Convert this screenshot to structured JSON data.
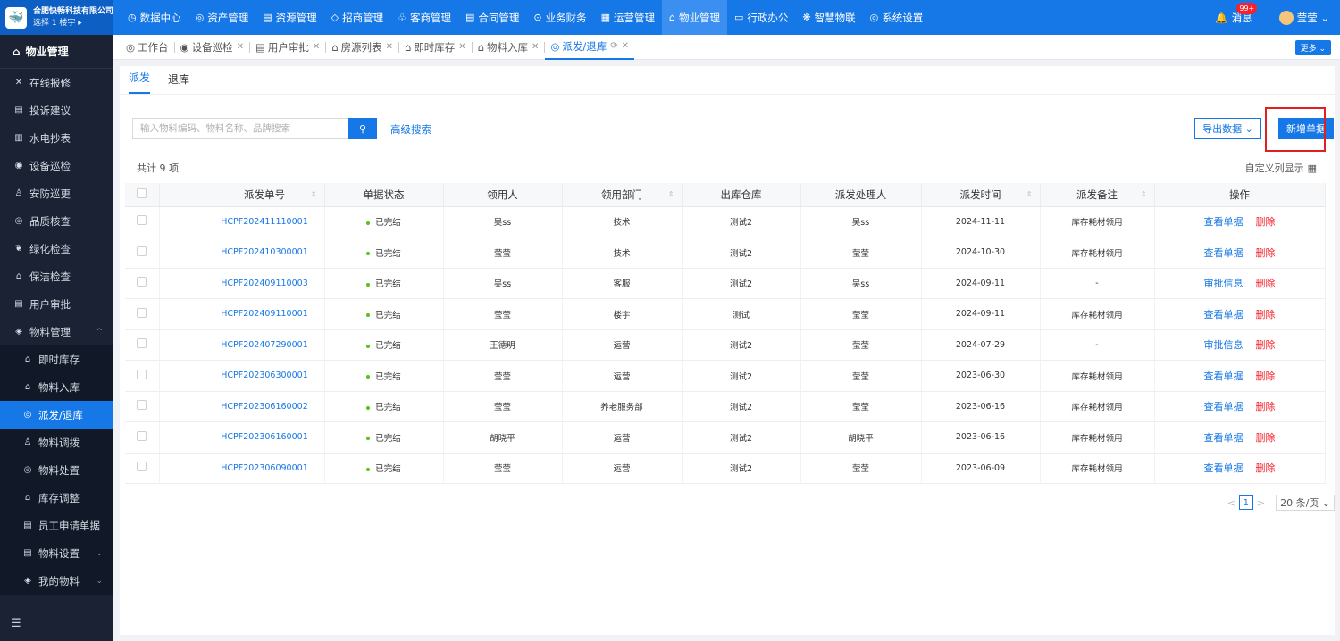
{
  "brand": {
    "name": "合肥快畅科技有限公司",
    "sub": "选择 1 楼宇 ▸",
    "logo": "🐳"
  },
  "topnav": [
    {
      "icon": "◷",
      "label": "数据中心"
    },
    {
      "icon": "◎",
      "label": "资产管理"
    },
    {
      "icon": "▤",
      "label": "资源管理"
    },
    {
      "icon": "◇",
      "label": "招商管理"
    },
    {
      "icon": "♧",
      "label": "客商管理"
    },
    {
      "icon": "▤",
      "label": "合同管理"
    },
    {
      "icon": "⊙",
      "label": "业务财务"
    },
    {
      "icon": "▦",
      "label": "运营管理"
    },
    {
      "icon": "⌂",
      "label": "物业管理"
    },
    {
      "icon": "▭",
      "label": "行政办公"
    },
    {
      "icon": "❋",
      "label": "智慧物联"
    },
    {
      "icon": "◎",
      "label": "系统设置"
    }
  ],
  "top_right": {
    "messages": "消息",
    "badge": "99+",
    "user": "莹莹 ⌄"
  },
  "sidebar": {
    "title": "物业管理",
    "items": [
      {
        "icon": "✕",
        "label": "在线报修"
      },
      {
        "icon": "▤",
        "label": "投诉建议"
      },
      {
        "icon": "▥",
        "label": "水电抄表"
      },
      {
        "icon": "◉",
        "label": "设备巡检"
      },
      {
        "icon": "♙",
        "label": "安防巡更"
      },
      {
        "icon": "◎",
        "label": "品质核查"
      },
      {
        "icon": "❦",
        "label": "绿化检查"
      },
      {
        "icon": "⌂",
        "label": "保洁检查"
      },
      {
        "icon": "▤",
        "label": "用户审批"
      },
      {
        "icon": "◈",
        "label": "物料管理",
        "arrow": "^"
      }
    ],
    "subitems": [
      {
        "icon": "⌂",
        "label": "即时库存"
      },
      {
        "icon": "⌂",
        "label": "物料入库"
      },
      {
        "icon": "◎",
        "label": "派发/退库"
      },
      {
        "icon": "♙",
        "label": "物料调拨"
      },
      {
        "icon": "◎",
        "label": "物料处置"
      },
      {
        "icon": "⌂",
        "label": "库存调整"
      },
      {
        "icon": "▤",
        "label": "员工申请单据"
      },
      {
        "icon": "▤",
        "label": "物料设置",
        "arrow": "⌄"
      },
      {
        "icon": "◈",
        "label": "我的物料",
        "arrow": "⌄"
      }
    ],
    "bottom_icon": "☰"
  },
  "tabs": [
    {
      "icon": "◎",
      "label": "工作台"
    },
    {
      "icon": "◉",
      "label": "设备巡检",
      "close": "✕"
    },
    {
      "icon": "▤",
      "label": "用户审批",
      "close": "✕"
    },
    {
      "icon": "⌂",
      "label": "房源列表",
      "close": "✕"
    },
    {
      "icon": "⌂",
      "label": "即时库存",
      "close": "✕"
    },
    {
      "icon": "⌂",
      "label": "物料入库",
      "close": "✕"
    },
    {
      "icon": "◎",
      "label": "派发/退库",
      "refresh": "⟳",
      "close": "✕"
    }
  ],
  "more_label": "更多 ⌄",
  "subtabs": [
    "派发",
    "退库"
  ],
  "search": {
    "placeholder": "输入物料编码、物料名称、品牌搜索",
    "button_icon": "🔍",
    "advanced": "高级搜索"
  },
  "export_label": "导出数据 ⌄",
  "new_label": "新增单据",
  "total": "共计 9 项",
  "custom_cols": "自定义列显示",
  "table": {
    "headers": [
      "派发单号",
      "单据状态",
      "领用人",
      "领用部门",
      "出库仓库",
      "派发处理人",
      "派发时间",
      "派发备注",
      "操作"
    ],
    "rows": [
      {
        "code": "HCPF202411110001",
        "status": "已完结",
        "user": "吴ss",
        "dept": "技术",
        "wh": "测试2",
        "handler": "吴ss",
        "time": "2024-11-11",
        "note": "库存耗材领用",
        "op": "查看单据",
        "del": "删除"
      },
      {
        "code": "HCPF202410300001",
        "status": "已完结",
        "user": "莹莹",
        "dept": "技术",
        "wh": "测试2",
        "handler": "莹莹",
        "time": "2024-10-30",
        "note": "库存耗材领用",
        "op": "查看单据",
        "del": "删除"
      },
      {
        "code": "HCPF202409110003",
        "status": "已完结",
        "user": "吴ss",
        "dept": "客服",
        "wh": "测试2",
        "handler": "吴ss",
        "time": "2024-09-11",
        "note": "-",
        "op": "审批信息",
        "del": "删除"
      },
      {
        "code": "HCPF202409110001",
        "status": "已完结",
        "user": "莹莹",
        "dept": "楼宇",
        "wh": "测试",
        "handler": "莹莹",
        "time": "2024-09-11",
        "note": "库存耗材领用",
        "op": "查看单据",
        "del": "删除"
      },
      {
        "code": "HCPF202407290001",
        "status": "已完结",
        "user": "王德明",
        "dept": "运营",
        "wh": "测试2",
        "handler": "莹莹",
        "time": "2024-07-29",
        "note": "-",
        "op": "审批信息",
        "del": "删除"
      },
      {
        "code": "HCPF202306300001",
        "status": "已完结",
        "user": "莹莹",
        "dept": "运营",
        "wh": "测试2",
        "handler": "莹莹",
        "time": "2023-06-30",
        "note": "库存耗材领用",
        "op": "查看单据",
        "del": "删除"
      },
      {
        "code": "HCPF202306160002",
        "status": "已完结",
        "user": "莹莹",
        "dept": "养老服务部",
        "wh": "测试2",
        "handler": "莹莹",
        "time": "2023-06-16",
        "note": "库存耗材领用",
        "op": "查看单据",
        "del": "删除"
      },
      {
        "code": "HCPF202306160001",
        "status": "已完结",
        "user": "胡晓平",
        "dept": "运营",
        "wh": "测试2",
        "handler": "胡晓平",
        "time": "2023-06-16",
        "note": "库存耗材领用",
        "op": "查看单据",
        "del": "删除"
      },
      {
        "code": "HCPF202306090001",
        "status": "已完结",
        "user": "莹莹",
        "dept": "运营",
        "wh": "测试2",
        "handler": "莹莹",
        "time": "2023-06-09",
        "note": "库存耗材领用",
        "op": "查看单据",
        "del": "删除"
      }
    ]
  },
  "pager": {
    "prev": "<",
    "page": "1",
    "next": ">",
    "size": "20 条/页 ⌄"
  }
}
